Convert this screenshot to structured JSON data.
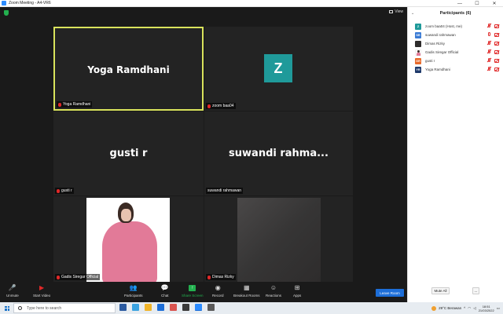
{
  "window": {
    "title": "Zoom Meeting - A4-VR6",
    "minimize": "—",
    "maximize": "☐",
    "close": "✕"
  },
  "view_label": "View",
  "tiles": [
    {
      "big_name": "Yoga Ramdhani",
      "label": "Yoga Ramdhani",
      "active": true
    },
    {
      "avatar_letter": "Z",
      "label": "zoom baa04"
    },
    {
      "big_name": "gusti r",
      "label": "gusti r"
    },
    {
      "big_name": "suwandi  rahma...",
      "label": "suwandi rahmawan"
    },
    {
      "label": "Gadis Siregar Official"
    },
    {
      "label": "Dimas Rizky"
    }
  ],
  "toolbar": {
    "unmute": "Unmute",
    "start_video": "Start Video",
    "participants": "Participants",
    "participants_count": "6",
    "chat": "Chat",
    "share_screen": "Share Screen",
    "record": "Record",
    "breakout_rooms": "Breakout Rooms",
    "reactions": "Reactions",
    "apps": "Apps",
    "leave": "Leave Room"
  },
  "panel": {
    "title": "Participants (6)",
    "participants": [
      {
        "initials": "Z",
        "name": "zoom baa04 (Host, me)",
        "color": "#1f9a9a"
      },
      {
        "initials": "SR",
        "name": "suwandi rahmawan",
        "color": "#3a7bd5"
      },
      {
        "initials": "",
        "name": "Dimas Rizky",
        "color": "#2e2c2c"
      },
      {
        "initials": "",
        "name": "Gadis Siregar Official",
        "color": "#ffffff"
      },
      {
        "initials": "GR",
        "name": "gusti r",
        "color": "#e86a2a"
      },
      {
        "initials": "YR",
        "name": "Yoga Ramdhani",
        "color": "#1f3a6b"
      }
    ],
    "mute_all": "Mute All",
    "more": "..."
  },
  "taskbar": {
    "search_placeholder": "Type here to search",
    "weather": "29°C  Berawan",
    "time": "18:51",
    "date": "21/03/2022"
  },
  "colors": {
    "accent": "#2d8cff",
    "mute_red": "#e02828",
    "active_speaker": "#d9e35c",
    "share_green": "#23b04f",
    "leave_blue": "#1d6ed8"
  }
}
